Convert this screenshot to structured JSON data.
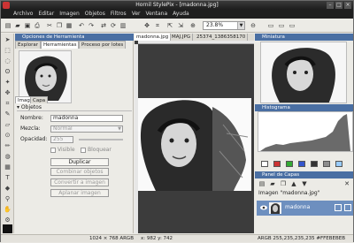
{
  "window": {
    "title": "Hornil StylePix - [madonna.jpg]"
  },
  "menu": [
    "Archivo",
    "Editar",
    "Imagen",
    "Objetos",
    "Filtros",
    "Ver",
    "Ventana",
    "Ayuda"
  ],
  "toolbar": {
    "zoom": "23.8%"
  },
  "left_panel": {
    "header": "Opciones de Herramienta",
    "tabs": [
      "Explorar",
      "Herramientas",
      "Proceso por lotes"
    ],
    "subtabs": [
      "Image",
      "Capa"
    ],
    "section_title": "Objetos",
    "fields": {
      "name_label": "Nombre:",
      "name_value": "madonna",
      "blend_label": "Mezcla:",
      "blend_value": "Normal",
      "opacity_label": "Opacidad:",
      "opacity_value": "255",
      "visible_label": "Visible",
      "lock_label": "Bloquear"
    },
    "buttons": [
      "Duplicar",
      "Combinar objetos",
      "Convertir a imagen",
      "Aplanar imagen"
    ]
  },
  "document": {
    "tabs": [
      "madonna.jpg",
      "MAJ.JPG",
      "25374_1386358170"
    ]
  },
  "right_panel": {
    "miniatura_header": "Miniatura",
    "histogram_header": "Histograma",
    "layers_header": "Panel de Capas",
    "layer_group": "Imagen \"madonna.jpg\"",
    "layer_name": "madonna"
  },
  "colors": {
    "swatches": [
      "#ffffff",
      "#cc3333",
      "#33aa33",
      "#3355cc",
      "#333333",
      "#8c8c8c",
      "#99ccff"
    ]
  },
  "status": {
    "size": "1024 × 768 ARGB",
    "pos": "x: 982 y: 742",
    "color": "ARGB 255,235,235,235 #FFEBEBEB"
  }
}
